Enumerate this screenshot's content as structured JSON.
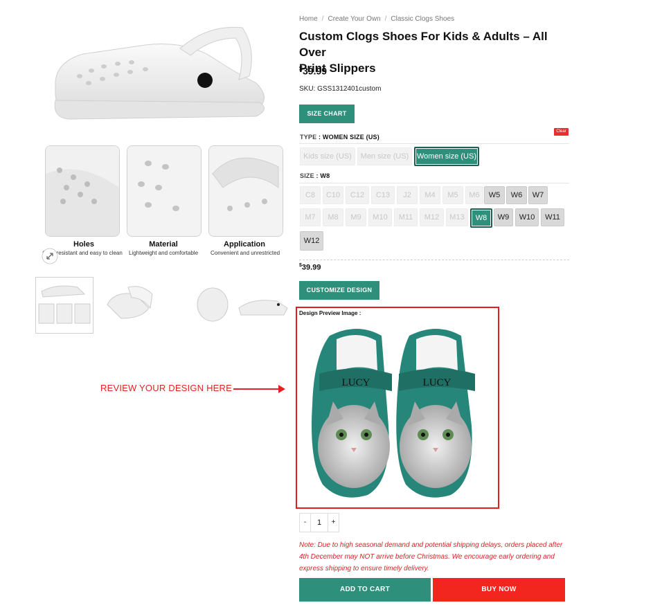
{
  "breadcrumb": {
    "home": "Home",
    "parent": "Create Your Own",
    "current": "Classic Clogs Shoes"
  },
  "product": {
    "title_line1": "Custom Clogs Shoes For Kids & Adults – All Over",
    "title_line2": "Print Slippers",
    "price_symbol": "$",
    "price_value": "39.99",
    "sku": "SKU: GSS1312401custom"
  },
  "buttons": {
    "size_chart": "SIZE CHART",
    "clear": "Clear",
    "customize": "CUSTOMIZE DESIGN",
    "add_to_cart": "ADD TO CART",
    "buy_now": "BUY NOW"
  },
  "type_selector": {
    "label": "TYPE",
    "selected": "WOMEN SIZE (US)",
    "options": [
      "Kids size (US)",
      "Men size (US)",
      "Women size (US)"
    ]
  },
  "size_selector": {
    "label": "SIZE",
    "selected": "W8",
    "row1": [
      "C8",
      "C10",
      "C12",
      "C13",
      "J2",
      "M4",
      "M5",
      "M6",
      "W5",
      "W6",
      "W7"
    ],
    "row2": [
      "M7",
      "M8",
      "M9",
      "M10",
      "M11",
      "M12",
      "M13",
      "W8",
      "W9",
      "W10",
      "W11"
    ],
    "row3": [
      "W12"
    ]
  },
  "variation_price": {
    "symbol": "$",
    "value": "39.99"
  },
  "design_preview": {
    "label": "Design Preview Image :",
    "name_on_strap": "LUCY"
  },
  "annotation": {
    "text": "REVIEW YOUR DESIGN HERE"
  },
  "features": [
    {
      "title": "Holes",
      "desc": "Odor-resistant and easy to clean"
    },
    {
      "title": "Material",
      "desc": "Lightweight and comfortable"
    },
    {
      "title": "Application",
      "desc": "Convenient and unrestricted"
    }
  ],
  "quantity": {
    "minus": "-",
    "value": "1",
    "plus": "+"
  },
  "note": "Note: Due to high seasonal demand and potential shipping delays, orders placed after 4th December may NOT arrive before Christmas. We encourage early ordering and express shipping to ensure timely delivery.",
  "colors": {
    "accent": "#2e8f7b",
    "buy_now": "#f3261f",
    "annotation": "#e32222"
  }
}
